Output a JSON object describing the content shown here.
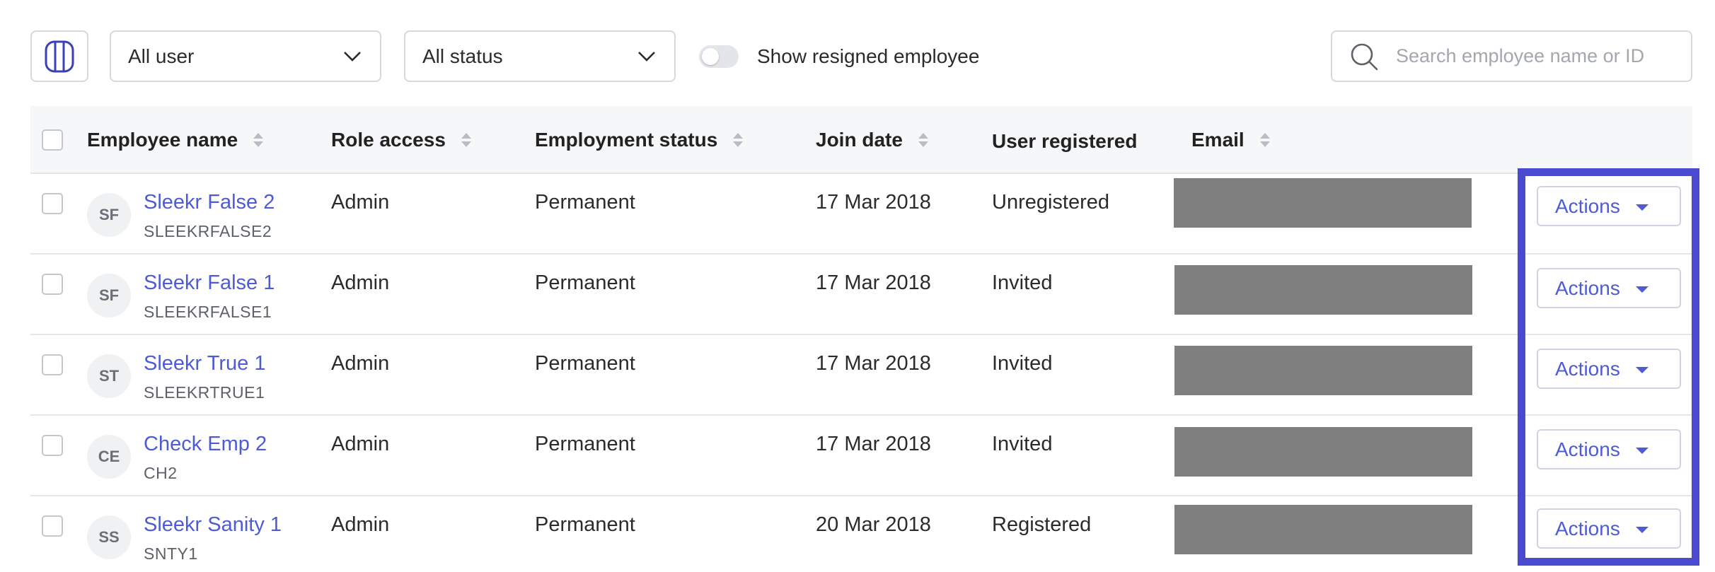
{
  "filters": {
    "user_select": "All user",
    "status_select": "All status",
    "show_resigned_label": "Show resigned employee",
    "show_resigned_on": false,
    "search_placeholder": "Search employee name or ID"
  },
  "table": {
    "headers": {
      "name": "Employee name",
      "role": "Role access",
      "status": "Employment status",
      "join": "Join date",
      "registered": "User registered",
      "email": "Email"
    },
    "rows": [
      {
        "initials": "SF",
        "name": "Sleekr False 2",
        "id": "SLEEKRFALSE2",
        "role": "Admin",
        "status": "Permanent",
        "join": "17 Mar 2018",
        "registered": "Unregistered",
        "action": "Actions"
      },
      {
        "initials": "SF",
        "name": "Sleekr False 1",
        "id": "SLEEKRFALSE1",
        "role": "Admin",
        "status": "Permanent",
        "join": "17 Mar 2018",
        "registered": "Invited",
        "action": "Actions"
      },
      {
        "initials": "ST",
        "name": "Sleekr True 1",
        "id": "SLEEKRTRUE1",
        "role": "Admin",
        "status": "Permanent",
        "join": "17 Mar 2018",
        "registered": "Invited",
        "action": "Actions"
      },
      {
        "initials": "CE",
        "name": "Check Emp 2",
        "id": "CH2",
        "role": "Admin",
        "status": "Permanent",
        "join": "17 Mar 2018",
        "registered": "Invited",
        "action": "Actions"
      },
      {
        "initials": "SS",
        "name": "Sleekr Sanity 1",
        "id": "SNTY1",
        "role": "Admin",
        "status": "Permanent",
        "join": "20 Mar 2018",
        "registered": "Registered",
        "action": "Actions"
      }
    ]
  },
  "colors": {
    "accent": "#4f5bd5",
    "highlight": "#4a4ad0",
    "email_redaction": "#7f7f7f"
  }
}
